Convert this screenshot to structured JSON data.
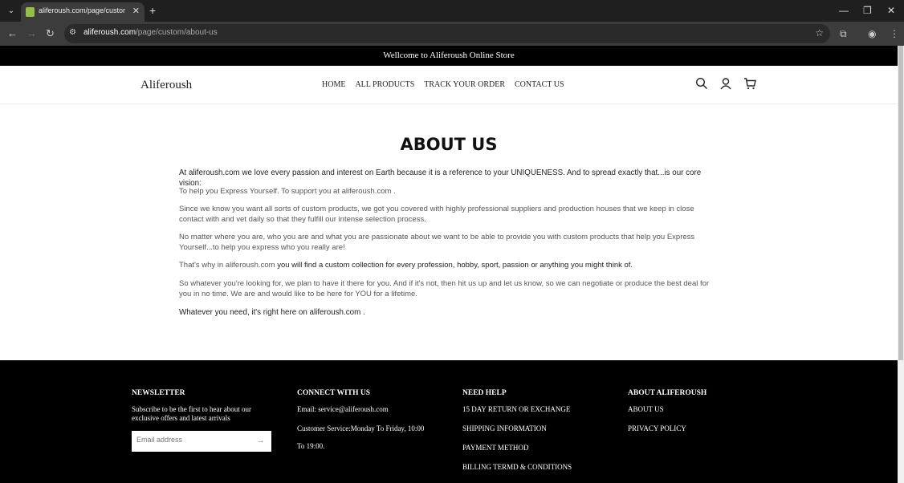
{
  "browser": {
    "tab_title": "aliferoush.com/page/custom/ab",
    "url_domain": "aliferoush.com",
    "url_path": "/page/custom/about-us"
  },
  "announcement": "Wellcome to Aliferoush Online Store",
  "header": {
    "logo": "Aliferoush",
    "nav": [
      "HOME",
      "ALL PRODUCTS",
      "TRACK YOUR ORDER",
      "CONTACT US"
    ],
    "icons": [
      "search-icon",
      "account-icon",
      "cart-icon"
    ]
  },
  "about": {
    "title": "ABOUT US",
    "p1": "At aliferoush.com  we love every passion and interest on Earth because it is a reference to your UNIQUENESS. And to spread exactly that...is our core vision:",
    "p2": "To help you Express Yourself. To support you at aliferoush.com .",
    "p3": "Since we know you want all sorts of custom products, we got you covered with highly professional suppliers and production houses that we keep in close contact with and vet daily so that they fulfill our intense selection process.",
    "p4": "No matter where you are, who you are and what you are passionate about we want to be able to provide you with custom products that help you Express Yourself...to help you express who you really are!",
    "p5_prefix": "That's why in aliferoush.com ",
    "p5_strong": "you will find a custom collection for every profession, hobby, sport, passion or anything you might think of.",
    "p6": "So whatever you're looking for, we plan to have it there for you. And if it's not, then hit us up and let us know, so we can negotiate or produce the best deal for you in no time. We are and would like to be here for YOU for a lifetime.",
    "p7": "Whatever you need, it's right here on aliferoush.com ."
  },
  "footer": {
    "newsletter": {
      "heading": "NEWSLETTER",
      "text": "Subscribe to be the first to hear about our exclusive offers and latest arrivals",
      "placeholder": "Email address"
    },
    "connect": {
      "heading": "CONNECT WITH US",
      "email": "Email: service@aliferoush.com",
      "service_1": "Customer Service:Monday To Friday, 10:00",
      "service_2": "To 19:00."
    },
    "help": {
      "heading": "NEED HELP",
      "items": [
        "15 DAY RETURN OR EXCHANGE",
        "SHIPPING INFORMATION",
        "PAYMENT METHOD",
        "BILLING TERMD & CONDITIONS"
      ]
    },
    "about": {
      "heading": "ABOUT ALIFEROUSH",
      "items": [
        "ABOUT US",
        "PRIVACY POLICY"
      ]
    }
  }
}
